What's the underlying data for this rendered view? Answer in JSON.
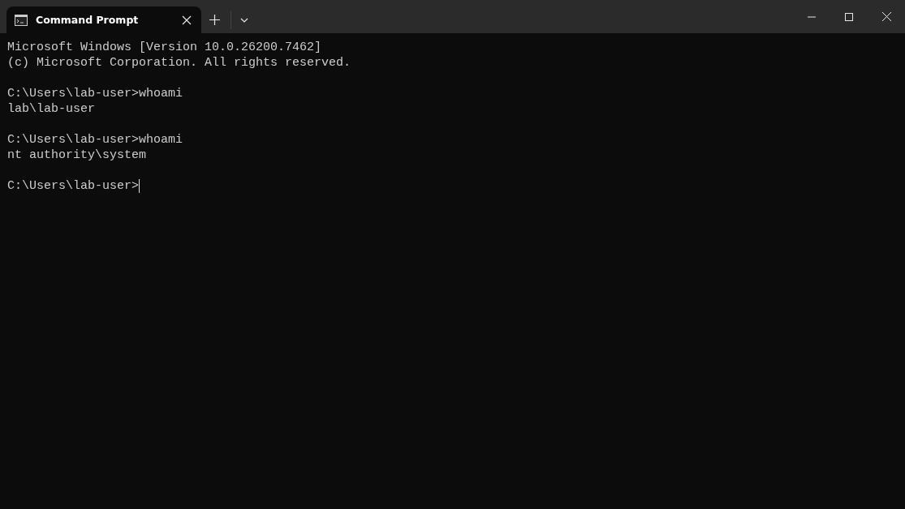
{
  "tabs": [
    {
      "title": "Command Prompt",
      "selected": true
    }
  ],
  "console": {
    "blocks": [
      {
        "lines": [
          {
            "text": "Microsoft Windows [Version 10.0.26200.7462]"
          },
          {
            "text": "(c) Microsoft Corporation. All rights reserved."
          }
        ]
      },
      {
        "lines": [
          {
            "text": "C:\\Users\\lab-user>whoami"
          },
          {
            "text": "lab\\lab-user"
          }
        ]
      },
      {
        "lines": [
          {
            "text": "C:\\Users\\lab-user>whoami"
          },
          {
            "text": "nt authority\\system"
          }
        ]
      },
      {
        "lines": [
          {
            "text": "C:\\Users\\lab-user>",
            "cursor": true
          }
        ]
      }
    ]
  }
}
